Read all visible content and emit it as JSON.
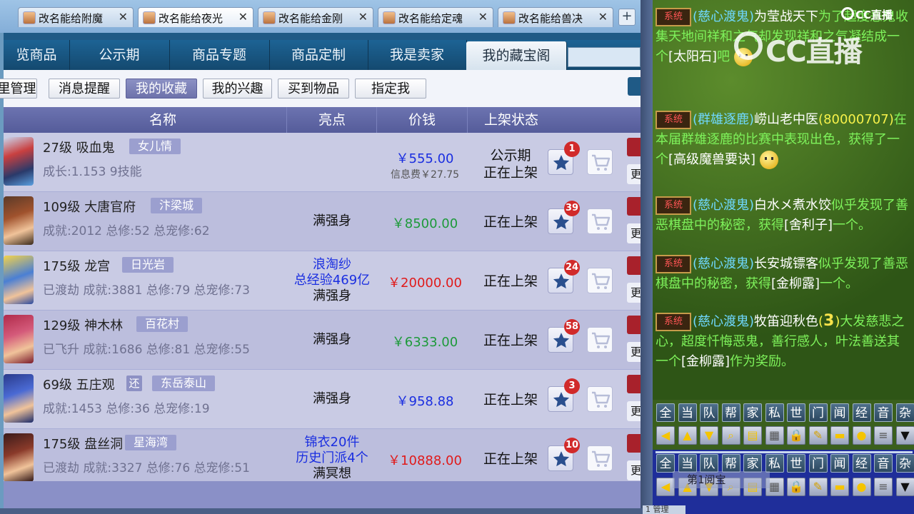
{
  "browser_tabs": [
    {
      "title": "改名能给附魔",
      "active": false
    },
    {
      "title": "改名能给夜光",
      "active": true
    },
    {
      "title": "改名能给金刚",
      "active": false
    },
    {
      "title": "改名能给定魂",
      "active": false
    },
    {
      "title": "改名能给兽决",
      "active": false
    }
  ],
  "new_tab_label": "+",
  "close_glyph": "✕",
  "nav": [
    "览商品",
    "公示期",
    "商品专题",
    "商品定制",
    "我是卖家",
    "我的藏宝阁"
  ],
  "subnav": [
    "里管理",
    "消息提醒",
    "我的收藏",
    "我的兴趣",
    "买到物品",
    "指定我"
  ],
  "table_headers": {
    "name": "名称",
    "highlight": "亮点",
    "price": "价钱",
    "status": "上架状态"
  },
  "rows": [
    {
      "level": "27级",
      "name": "吸血鬼",
      "server": "女儿情",
      "stats": "成长:1.153 9技能",
      "highlight": [],
      "price": "￥555.00",
      "fee": "信息费￥27.75",
      "status": [
        "公示期",
        "正在上架"
      ],
      "favorites": "1",
      "side": "更"
    },
    {
      "level": "109级",
      "name": "大唐官府",
      "server": "汴梁城",
      "stats": "成就:2012 总修:52 总宠修:62",
      "highlight": [
        "满强身"
      ],
      "price": "￥8500.00",
      "status": [
        "正在上架"
      ],
      "favorites": "39",
      "side": "更"
    },
    {
      "level": "175级",
      "name": "龙宫",
      "server": "日光岩",
      "stats": "已渡劫 成就:3881 总修:79 总宠修:73",
      "highlight": [
        "浪淘纱",
        "总经验469亿",
        "满强身"
      ],
      "price": "￥20000.00",
      "status": [
        "正在上架"
      ],
      "favorites": "24",
      "side": "更"
    },
    {
      "level": "129级",
      "name": "神木林",
      "server": "百花村",
      "stats": "已飞升 成就:1686 总修:81 总宠修:55",
      "highlight": [
        "满强身"
      ],
      "price": "￥6333.00",
      "status": [
        "正在上架"
      ],
      "favorites": "58",
      "side": "更"
    },
    {
      "level": "69级",
      "name": "五庄观",
      "huan": "还",
      "server": "东岳泰山",
      "stats": "成就:1453 总修:36 总宠修:19",
      "highlight": [
        "满强身"
      ],
      "price": "￥958.88",
      "status": [
        "正在上架"
      ],
      "favorites": "3",
      "side": "更"
    },
    {
      "level": "175级",
      "name": "盘丝洞",
      "server": "星海湾",
      "stats": "已渡劫 成就:3327 总修:76 总宠修:51",
      "highlight": [
        "锦衣20件",
        "历史门派4个",
        "满冥想"
      ],
      "price": "￥10888.00",
      "status": [
        "正在上架"
      ],
      "favorites": "10",
      "side": "更"
    }
  ],
  "colors": {
    "price_blue": "#1a2ee0",
    "price_green": "#1d9a3a",
    "price_red": "#e01a1a",
    "nav_bg": "#1a5684",
    "table_header": "#5f66a5",
    "chat_name": "#7ee8ff"
  },
  "chat": {
    "sys_label": "系统",
    "messages": [
      {
        "parts": [
          "(慈心渡鬼)",
          "为莹战天下",
          "为了超度恶",
          "鬼收集天地间祥和之气",
          "却发现祥和之气",
          "凝结成一个",
          "[太阳石]",
          "吧"
        ],
        "emoji": "sad-face-icon"
      },
      {
        "parts": [
          "(群雄逐鹿)",
          "崂山老中医",
          "(8000",
          "0707)",
          "在本届群雄逐鹿的比赛中表现出色，获得了一个",
          "[高级魔兽要诀]"
        ],
        "emoji": "grin-face-icon"
      },
      {
        "parts": [
          "(慈心渡鬼)",
          "白水メ煮水饺",
          "似乎发现了善恶棋盘中的秘密，获得",
          "[舍利子]",
          "一个。"
        ]
      },
      {
        "parts": [
          "(慈心渡鬼)",
          "长安城镖客",
          "似乎发现了善恶棋盘中的秘密，获得",
          "[金柳露]",
          "一个。"
        ]
      },
      {
        "parts": [
          "(慈心渡鬼)",
          "牧笛迎秋色",
          "(",
          "3",
          ")",
          "大发慈悲之心，超度忏悔恶鬼，善行感人，叶法善送其一个",
          "[金柳露]",
          "作为奖励。"
        ]
      }
    ],
    "channels": [
      "全",
      "当",
      "队",
      "帮",
      "家",
      "私",
      "世",
      "门",
      "闻",
      "经",
      "音",
      "杂"
    ],
    "tooltip": "第1阅宝",
    "footer": "1 管理"
  },
  "watermark": "CC直播",
  "logo": "CC直播"
}
